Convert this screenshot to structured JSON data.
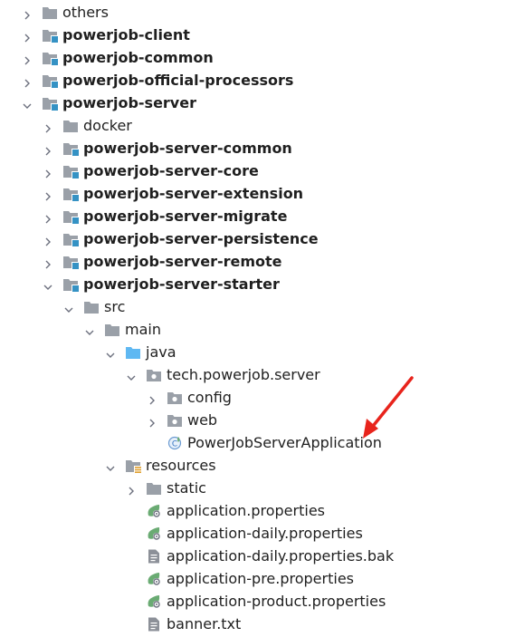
{
  "tree": {
    "nodes": [
      {
        "label": "others",
        "depth": 0,
        "expanded": false,
        "icon": "folder-icon",
        "bold": false
      },
      {
        "label": "powerjob-client",
        "depth": 0,
        "expanded": false,
        "icon": "module-folder-icon",
        "bold": true
      },
      {
        "label": "powerjob-common",
        "depth": 0,
        "expanded": false,
        "icon": "module-folder-icon",
        "bold": true
      },
      {
        "label": "powerjob-official-processors",
        "depth": 0,
        "expanded": false,
        "icon": "module-folder-icon",
        "bold": true
      },
      {
        "label": "powerjob-server",
        "depth": 0,
        "expanded": true,
        "icon": "module-folder-icon",
        "bold": true
      },
      {
        "label": "docker",
        "depth": 1,
        "expanded": false,
        "icon": "folder-icon",
        "bold": false
      },
      {
        "label": "powerjob-server-common",
        "depth": 1,
        "expanded": false,
        "icon": "module-folder-icon",
        "bold": true
      },
      {
        "label": "powerjob-server-core",
        "depth": 1,
        "expanded": false,
        "icon": "module-folder-icon",
        "bold": true
      },
      {
        "label": "powerjob-server-extension",
        "depth": 1,
        "expanded": false,
        "icon": "module-folder-icon",
        "bold": true
      },
      {
        "label": "powerjob-server-migrate",
        "depth": 1,
        "expanded": false,
        "icon": "module-folder-icon",
        "bold": true
      },
      {
        "label": "powerjob-server-persistence",
        "depth": 1,
        "expanded": false,
        "icon": "module-folder-icon",
        "bold": true
      },
      {
        "label": "powerjob-server-remote",
        "depth": 1,
        "expanded": false,
        "icon": "module-folder-icon",
        "bold": true
      },
      {
        "label": "powerjob-server-starter",
        "depth": 1,
        "expanded": true,
        "icon": "module-folder-icon",
        "bold": true
      },
      {
        "label": "src",
        "depth": 2,
        "expanded": true,
        "icon": "folder-icon",
        "bold": false
      },
      {
        "label": "main",
        "depth": 3,
        "expanded": true,
        "icon": "folder-icon",
        "bold": false
      },
      {
        "label": "java",
        "depth": 4,
        "expanded": true,
        "icon": "source-folder-icon",
        "bold": false
      },
      {
        "label": "tech.powerjob.server",
        "depth": 5,
        "expanded": true,
        "icon": "package-icon",
        "bold": false
      },
      {
        "label": "config",
        "depth": 6,
        "expanded": false,
        "icon": "package-icon",
        "bold": false
      },
      {
        "label": "web",
        "depth": 6,
        "expanded": false,
        "icon": "package-icon",
        "bold": false
      },
      {
        "label": "PowerJobServerApplication",
        "depth": 6,
        "expanded": null,
        "icon": "spring-class-icon",
        "bold": false
      },
      {
        "label": "resources",
        "depth": 4,
        "expanded": true,
        "icon": "resources-folder-icon",
        "bold": false
      },
      {
        "label": "static",
        "depth": 5,
        "expanded": false,
        "icon": "folder-icon",
        "bold": false
      },
      {
        "label": "application.properties",
        "depth": 5,
        "expanded": null,
        "icon": "spring-properties-icon",
        "bold": false
      },
      {
        "label": "application-daily.properties",
        "depth": 5,
        "expanded": null,
        "icon": "spring-properties-icon",
        "bold": false
      },
      {
        "label": "application-daily.properties.bak",
        "depth": 5,
        "expanded": null,
        "icon": "text-file-icon",
        "bold": false
      },
      {
        "label": "application-pre.properties",
        "depth": 5,
        "expanded": null,
        "icon": "spring-properties-icon",
        "bold": false
      },
      {
        "label": "application-product.properties",
        "depth": 5,
        "expanded": null,
        "icon": "spring-properties-icon",
        "bold": false
      },
      {
        "label": "banner.txt",
        "depth": 5,
        "expanded": null,
        "icon": "text-file-icon",
        "bold": false
      }
    ]
  },
  "colors": {
    "chevron": "#6c707e",
    "folder": "#9aa0a8",
    "module_badge": "#3592c4",
    "source_folder": "#5fb8f2",
    "spring_green": "#6aab73",
    "annotation_arrow": "#e8241c"
  },
  "annotation": {
    "target": "PowerJobServerApplication",
    "shape": "red-arrow"
  }
}
